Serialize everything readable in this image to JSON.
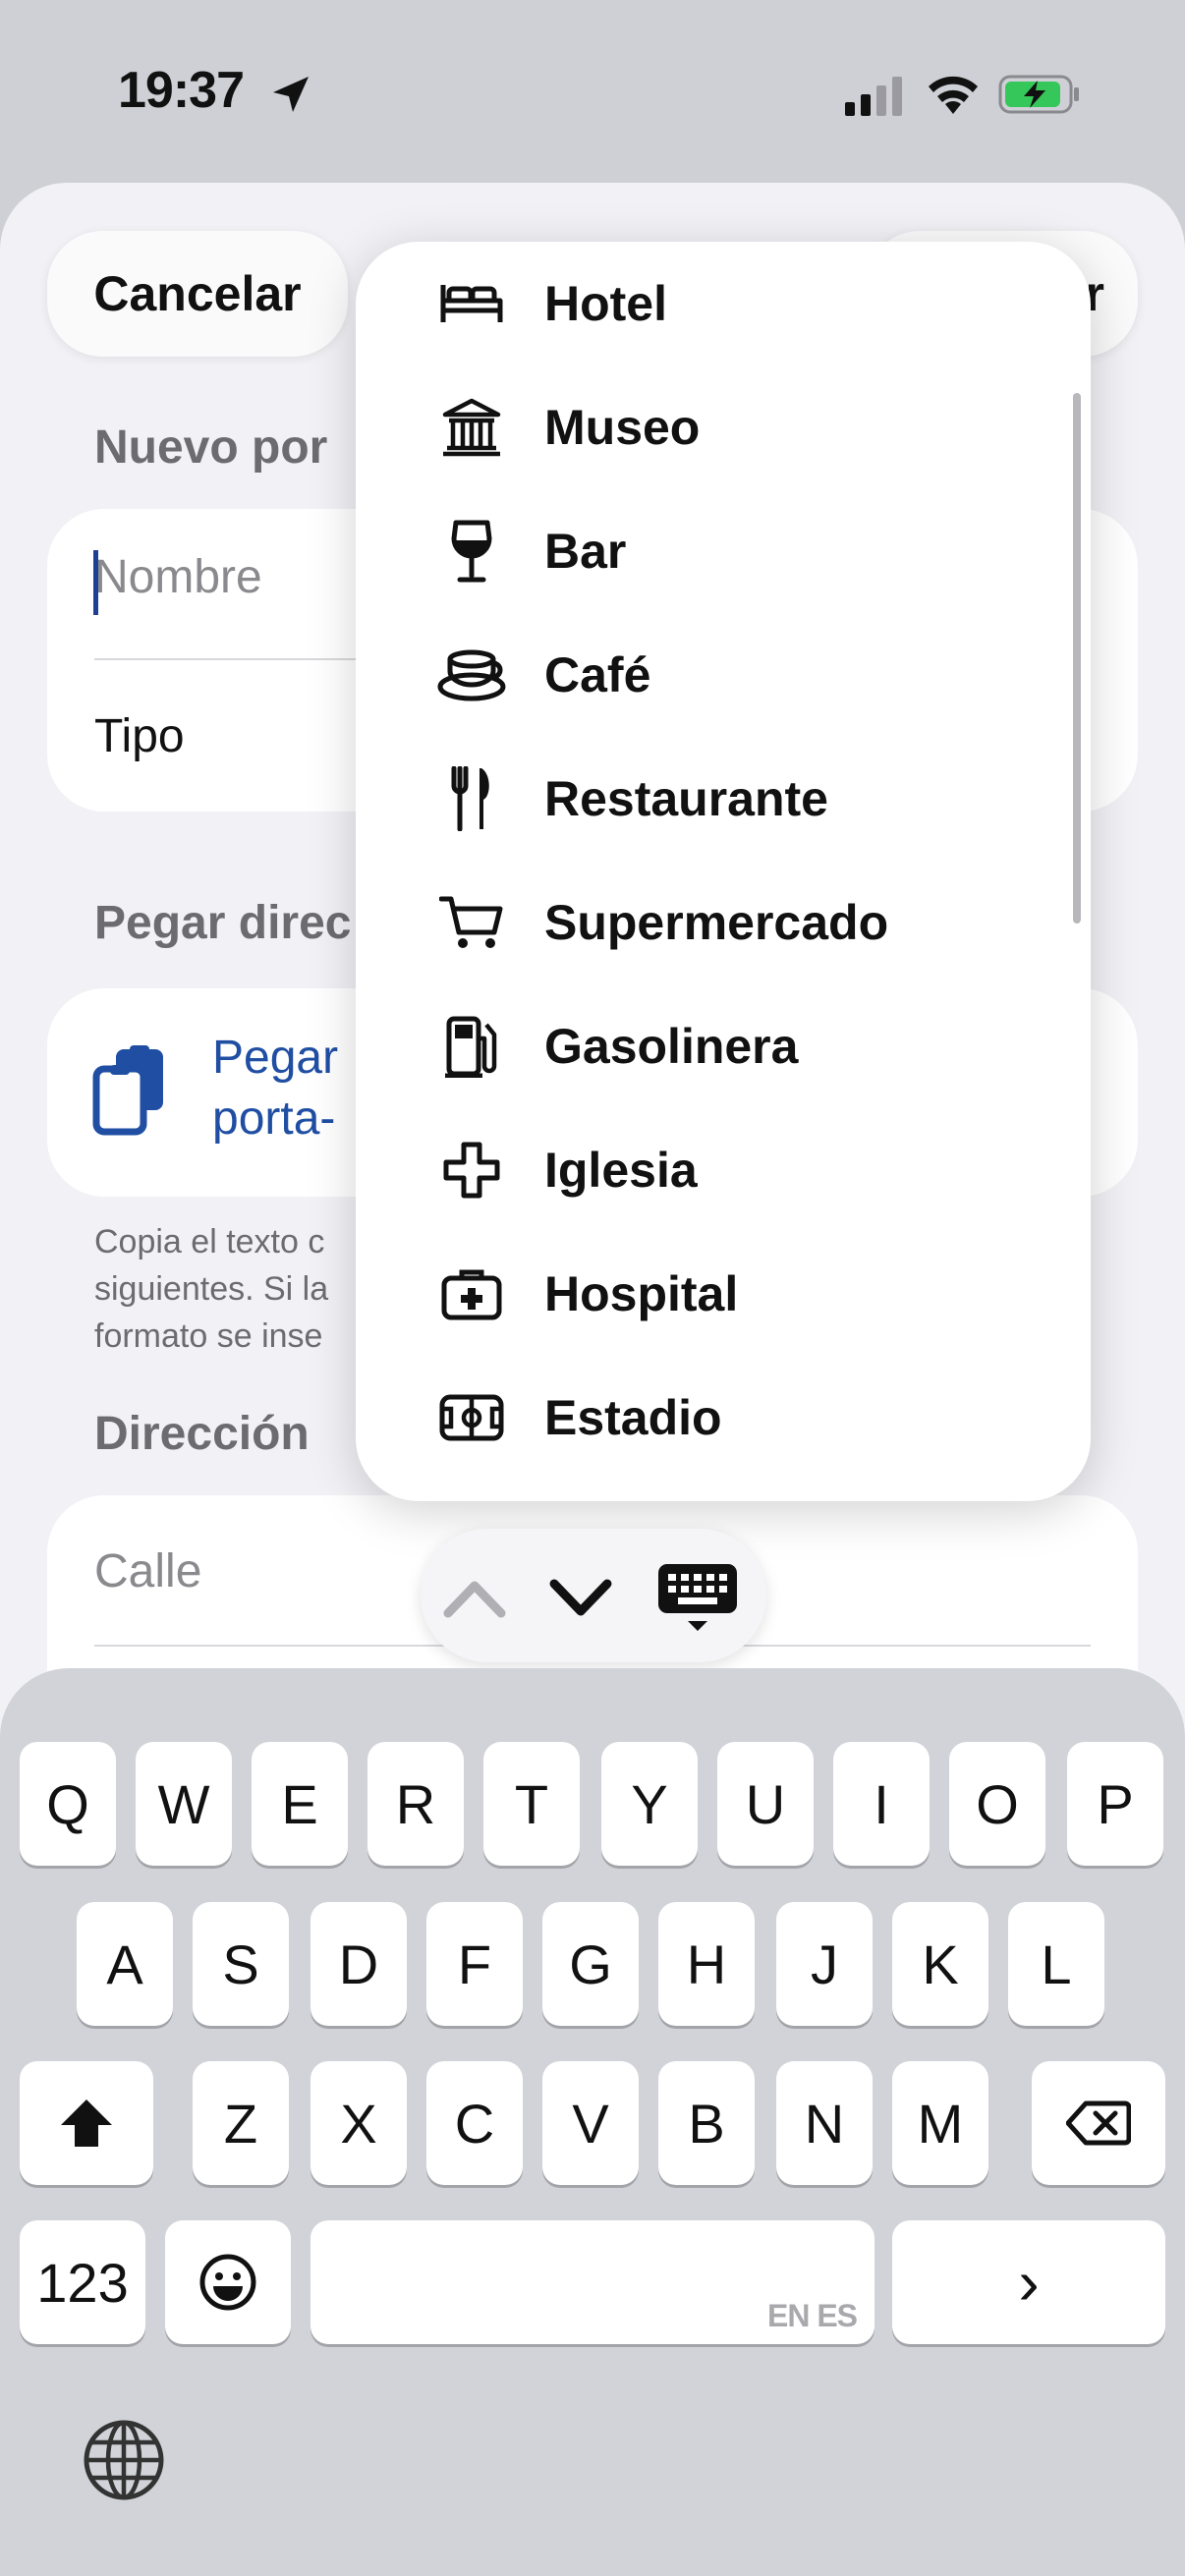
{
  "status_bar": {
    "time": "19:37"
  },
  "header": {
    "cancel_label": "Cancelar",
    "save_label": "r"
  },
  "form": {
    "section_new": "Nuevo por",
    "name_placeholder": "Nombre",
    "type_label": "Tipo",
    "section_paste": "Pegar direc",
    "paste_button_text": "Pegar\nporta-",
    "footnote_lines": [
      "Copia el texto c",
      "siguientes. Si la",
      "formato se inse"
    ],
    "section_address": "Dirección",
    "street_placeholder": "Calle"
  },
  "type_menu": {
    "items": [
      {
        "label": "Hotel",
        "icon": "bed-icon"
      },
      {
        "label": "Museo",
        "icon": "museum-icon"
      },
      {
        "label": "Bar",
        "icon": "wine-glass-icon"
      },
      {
        "label": "Café",
        "icon": "coffee-cup-icon"
      },
      {
        "label": "Restaurante",
        "icon": "fork-knife-icon"
      },
      {
        "label": "Supermercado",
        "icon": "cart-icon"
      },
      {
        "label": "Gasolinera",
        "icon": "fuel-pump-icon"
      },
      {
        "label": "Iglesia",
        "icon": "cross-icon"
      },
      {
        "label": "Hospital",
        "icon": "medical-bag-icon"
      },
      {
        "label": "Estadio",
        "icon": "stadium-icon"
      }
    ]
  },
  "keyboard": {
    "row1": [
      "Q",
      "W",
      "E",
      "R",
      "T",
      "Y",
      "U",
      "I",
      "O",
      "P"
    ],
    "row2": [
      "A",
      "S",
      "D",
      "F",
      "G",
      "H",
      "J",
      "K",
      "L"
    ],
    "row3": [
      "Z",
      "X",
      "C",
      "V",
      "B",
      "N",
      "M"
    ],
    "numbers_label": "123",
    "space_languages": "EN ES",
    "return_glyph": "›"
  },
  "colors": {
    "accent": "#1f4ea3",
    "background": "#f1f1f6",
    "keyboard": "#d1d3d9"
  }
}
